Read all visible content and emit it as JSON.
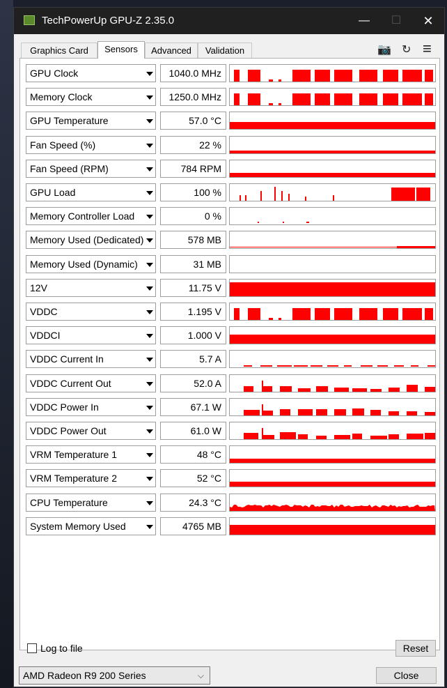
{
  "window": {
    "title": "TechPowerUp GPU-Z 2.35.0",
    "minimize_glyph": "—",
    "maximize_glyph": "☐",
    "close_glyph": "✕"
  },
  "tabs": [
    {
      "label": "Graphics Card",
      "active": false
    },
    {
      "label": "Sensors",
      "active": true
    },
    {
      "label": "Advanced",
      "active": false
    },
    {
      "label": "Validation",
      "active": false
    }
  ],
  "toolbar": {
    "camera_icon": "camera-icon",
    "refresh_icon": "refresh-icon",
    "menu_icon": "hamburger-menu-icon",
    "camera_glyph": "📷",
    "refresh_glyph": "↻",
    "menu_glyph": "≡"
  },
  "graph_color": "#ff0000",
  "sensors": [
    {
      "name": "GPU Clock",
      "value": "1040.0 MHz",
      "level": 0.7,
      "pattern": "blocks"
    },
    {
      "name": "Memory Clock",
      "value": "1250.0 MHz",
      "level": 0.7,
      "pattern": "blocks"
    },
    {
      "name": "GPU Temperature",
      "value": "57.0 °C",
      "level": 0.4,
      "pattern": "solid"
    },
    {
      "name": "Fan Speed (%)",
      "value": "22 %",
      "level": 0.15,
      "pattern": "solid"
    },
    {
      "name": "Fan Speed (RPM)",
      "value": "784 RPM",
      "level": 0.25,
      "pattern": "solid"
    },
    {
      "name": "GPU Load",
      "value": "100 %",
      "level": 0.8,
      "pattern": "spikes"
    },
    {
      "name": "Memory Controller Load",
      "value": "0 %",
      "level": 0.05,
      "pattern": "dots"
    },
    {
      "name": "Memory Used (Dedicated)",
      "value": "578 MB",
      "level": 0.1,
      "pattern": "line"
    },
    {
      "name": "Memory Used (Dynamic)",
      "value": "31 MB",
      "level": 0.0,
      "pattern": "none"
    },
    {
      "name": "12V",
      "value": "11.75 V",
      "level": 0.85,
      "pattern": "solid"
    },
    {
      "name": "VDDC",
      "value": "1.195 V",
      "level": 0.7,
      "pattern": "blocks"
    },
    {
      "name": "VDDCI",
      "value": "1.000 V",
      "level": 0.55,
      "pattern": "solid"
    },
    {
      "name": "VDDC Current In",
      "value": "5.7 A",
      "level": 0.08,
      "pattern": "dashes"
    },
    {
      "name": "VDDC Current Out",
      "value": "52.0 A",
      "level": 0.3,
      "pattern": "bumps"
    },
    {
      "name": "VDDC Power In",
      "value": "67.1 W",
      "level": 0.3,
      "pattern": "bumps"
    },
    {
      "name": "VDDC Power Out",
      "value": "61.0 W",
      "level": 0.3,
      "pattern": "bumps"
    },
    {
      "name": "VRM Temperature 1",
      "value": "48 °C",
      "level": 0.25,
      "pattern": "solid"
    },
    {
      "name": "VRM Temperature 2",
      "value": "52 °C",
      "level": 0.3,
      "pattern": "solid"
    },
    {
      "name": "CPU Temperature",
      "value": "24.3 °C",
      "level": 0.2,
      "pattern": "noisy"
    },
    {
      "name": "System Memory Used",
      "value": "4765 MB",
      "level": 0.6,
      "pattern": "solid"
    }
  ],
  "footer": {
    "log_label": "Log to file",
    "log_checked": false,
    "reset_label": "Reset",
    "gpu_selected": "AMD Radeon R9 200 Series",
    "close_label": "Close",
    "chevron_glyph": "⌵"
  }
}
